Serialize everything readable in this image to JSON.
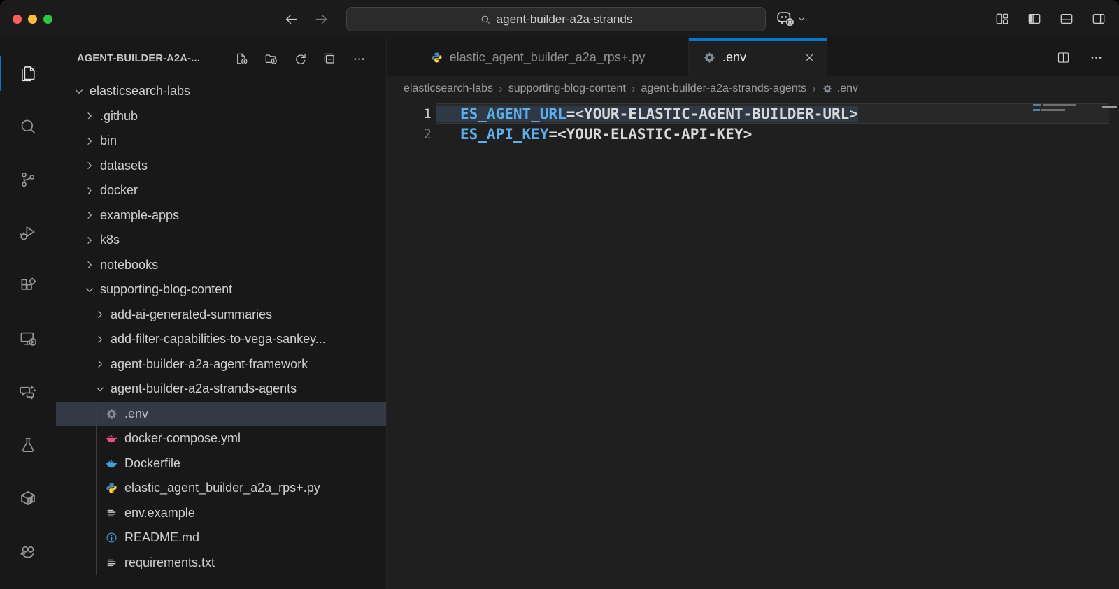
{
  "titlebar": {
    "search_value": "agent-builder-a2a-strands",
    "window_controls": [
      "close",
      "minimize",
      "zoom"
    ],
    "right_actions": [
      "customize-layout",
      "toggle-primary-sidebar",
      "toggle-panel",
      "toggle-secondary-sidebar"
    ]
  },
  "activity_bar": {
    "items": [
      {
        "name": "explorer",
        "active": true
      },
      {
        "name": "search",
        "active": false
      },
      {
        "name": "source-control",
        "active": false
      },
      {
        "name": "run-debug",
        "active": false
      },
      {
        "name": "extensions",
        "active": false
      },
      {
        "name": "remote-explorer",
        "active": false
      },
      {
        "name": "chat",
        "active": false
      },
      {
        "name": "testing",
        "active": false
      },
      {
        "name": "containers",
        "active": false
      },
      {
        "name": "snake",
        "active": false
      }
    ]
  },
  "sidebar": {
    "title": "AGENT-BUILDER-A2A-...",
    "actions": [
      "new-file",
      "new-folder",
      "refresh-explorer",
      "collapse-folders",
      "more-actions"
    ],
    "tree": [
      {
        "label": "elasticsearch-labs",
        "level": 0,
        "kind": "folder",
        "expanded": true
      },
      {
        "label": ".github",
        "level": 1,
        "kind": "folder",
        "expanded": false
      },
      {
        "label": "bin",
        "level": 1,
        "kind": "folder",
        "expanded": false
      },
      {
        "label": "datasets",
        "level": 1,
        "kind": "folder",
        "expanded": false
      },
      {
        "label": "docker",
        "level": 1,
        "kind": "folder",
        "expanded": false
      },
      {
        "label": "example-apps",
        "level": 1,
        "kind": "folder",
        "expanded": false
      },
      {
        "label": "k8s",
        "level": 1,
        "kind": "folder",
        "expanded": false
      },
      {
        "label": "notebooks",
        "level": 1,
        "kind": "folder",
        "expanded": false
      },
      {
        "label": "supporting-blog-content",
        "level": 1,
        "kind": "folder",
        "expanded": true
      },
      {
        "label": "add-ai-generated-summaries",
        "level": 2,
        "kind": "folder",
        "expanded": false
      },
      {
        "label": "add-filter-capabilities-to-vega-sankey...",
        "level": 2,
        "kind": "folder",
        "expanded": false
      },
      {
        "label": "agent-builder-a2a-agent-framework",
        "level": 2,
        "kind": "folder",
        "expanded": false
      },
      {
        "label": "agent-builder-a2a-strands-agents",
        "level": 2,
        "kind": "folder",
        "expanded": true
      },
      {
        "label": ".env",
        "level": 3,
        "kind": "file",
        "icon": "gear",
        "selected": true
      },
      {
        "label": "docker-compose.yml",
        "level": 3,
        "kind": "file",
        "icon": "docker-pink",
        "selected": false
      },
      {
        "label": "Dockerfile",
        "level": 3,
        "kind": "file",
        "icon": "docker-blue",
        "selected": false
      },
      {
        "label": "elastic_agent_builder_a2a_rps+.py",
        "level": 3,
        "kind": "file",
        "icon": "python",
        "selected": false
      },
      {
        "label": "env.example",
        "level": 3,
        "kind": "file",
        "icon": "text",
        "selected": false
      },
      {
        "label": "README.md",
        "level": 3,
        "kind": "file",
        "icon": "info",
        "selected": false
      },
      {
        "label": "requirements.txt",
        "level": 3,
        "kind": "file",
        "icon": "text",
        "selected": false
      }
    ]
  },
  "editor": {
    "tabs": [
      {
        "label": "elastic_agent_builder_a2a_rps+.py",
        "icon": "python",
        "active": false,
        "closable": false
      },
      {
        "label": ".env",
        "icon": "gear",
        "active": true,
        "closable": true
      }
    ],
    "actions": [
      "split-editor",
      "more-actions"
    ],
    "breadcrumbs": [
      {
        "label": "elasticsearch-labs"
      },
      {
        "label": "supporting-blog-content"
      },
      {
        "label": "agent-builder-a2a-strands-agents"
      },
      {
        "label": ".env",
        "icon": "gear"
      }
    ],
    "lines": [
      {
        "num": "1",
        "key": "ES_AGENT_URL",
        "rest": "=<YOUR-ELASTIC-AGENT-BUILDER-URL>",
        "current": true,
        "selected": true
      },
      {
        "num": "2",
        "key": "ES_API_KEY",
        "rest": "=<YOUR-ELASTIC-API-KEY>",
        "current": false,
        "selected": false
      }
    ]
  },
  "colors": {
    "accent": "#0078d4",
    "env_key": "#5cb0ee",
    "docker_pink": "#e2537a",
    "docker_blue": "#42a0dd",
    "python_blue": "#4b8bbe",
    "python_yellow": "#ffd43b",
    "readme_info": "#42a0dd",
    "traffic_red": "#ff5f57",
    "traffic_yellow": "#febc2e",
    "traffic_green": "#28c840"
  }
}
